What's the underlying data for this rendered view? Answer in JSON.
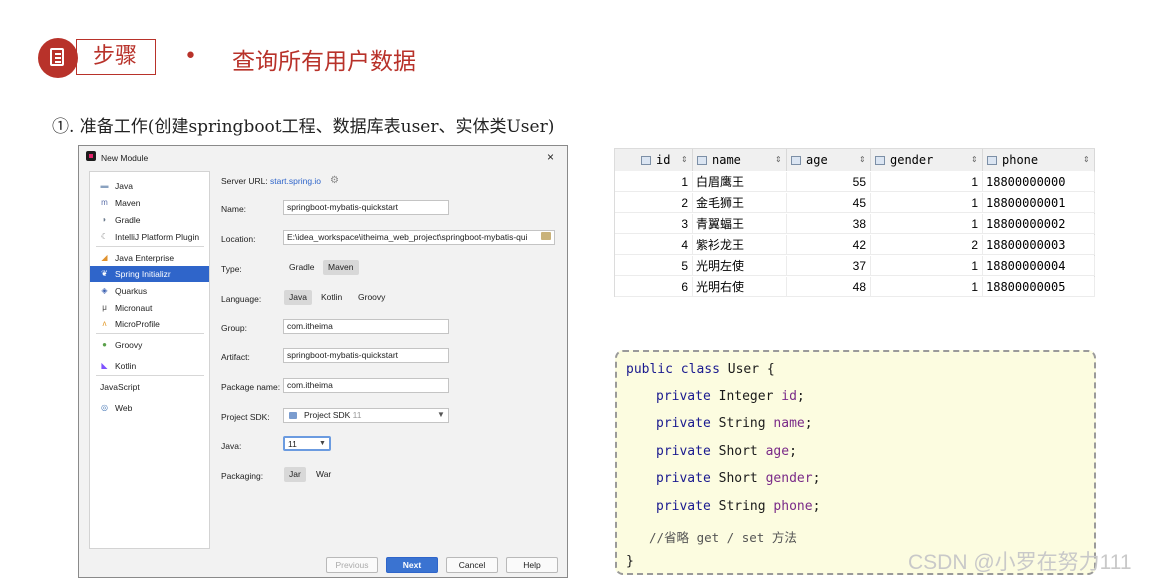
{
  "header": {
    "step_label": "步骤",
    "bullet": "•",
    "title": "查询所有用户数据",
    "subtitle": "①. 准备工作(创建springboot工程、数据库表user、实体类User)"
  },
  "dialog": {
    "title": "New Module",
    "close": "×",
    "sidebar": [
      {
        "label": "Java",
        "icon": "folder-icon"
      },
      {
        "label": "Maven",
        "icon": "maven-icon"
      },
      {
        "label": "Gradle",
        "icon": "gradle-icon"
      },
      {
        "label": "IntelliJ Platform Plugin",
        "icon": "plugin-icon"
      },
      {
        "label": "Java Enterprise",
        "icon": "enterprise-icon"
      },
      {
        "label": "Spring Initializr",
        "icon": "spring-icon",
        "selected": true
      },
      {
        "label": "Quarkus",
        "icon": "quarkus-icon"
      },
      {
        "label": "Micronaut",
        "icon": "micronaut-icon"
      },
      {
        "label": "MicroProfile",
        "icon": "microprofile-icon"
      },
      {
        "label": "Groovy",
        "icon": "groovy-icon"
      },
      {
        "label": "Kotlin",
        "icon": "kotlin-icon"
      },
      {
        "label": "JavaScript",
        "icon": ""
      },
      {
        "label": "Web",
        "icon": "web-icon"
      }
    ],
    "server_url_label": "Server URL:",
    "server_url": "start.spring.io",
    "name_label": "Name:",
    "name_value": "springboot-mybatis-quickstart",
    "location_label": "Location:",
    "location_value": "E:\\idea_workspace\\itheima_web_project\\springboot-mybatis-qui",
    "type_label": "Type:",
    "type_options": [
      "Gradle",
      "Maven"
    ],
    "type_selected": "Maven",
    "language_label": "Language:",
    "language_options": [
      "Java",
      "Kotlin",
      "Groovy"
    ],
    "language_selected": "Java",
    "group_label": "Group:",
    "group_value": "com.itheima",
    "artifact_label": "Artifact:",
    "artifact_value": "springboot-mybatis-quickstart",
    "package_label": "Package name:",
    "package_value": "com.itheima",
    "sdk_label": "Project SDK:",
    "sdk_value": "Project SDK",
    "sdk_version": "11",
    "java_label": "Java:",
    "java_value": "11",
    "packaging_label": "Packaging:",
    "packaging_options": [
      "Jar",
      "War"
    ],
    "packaging_selected": "Jar",
    "buttons": {
      "previous": "Previous",
      "next": "Next",
      "cancel": "Cancel",
      "help": "Help"
    },
    "accent_color": "#2f65ca"
  },
  "db_table": {
    "columns": [
      "id",
      "name",
      "age",
      "gender",
      "phone"
    ],
    "rows": [
      [
        "1",
        "白眉鹰王",
        "55",
        "1",
        "18800000000"
      ],
      [
        "2",
        "金毛狮王",
        "45",
        "1",
        "18800000001"
      ],
      [
        "3",
        "青翼蝠王",
        "38",
        "1",
        "18800000002"
      ],
      [
        "4",
        "紫衫龙王",
        "42",
        "2",
        "18800000003"
      ],
      [
        "5",
        "光明左使",
        "37",
        "1",
        "18800000004"
      ],
      [
        "6",
        "光明右使",
        "48",
        "1",
        "18800000005"
      ]
    ]
  },
  "code": {
    "l1_kw": "public class",
    "l1_rest": " User {",
    "fields": [
      {
        "kw": "private",
        "type": "Integer",
        "name": "id"
      },
      {
        "kw": "private",
        "type": "String",
        "name": "name"
      },
      {
        "kw": "private",
        "type": "Short",
        "name": "age"
      },
      {
        "kw": "private",
        "type": "Short",
        "name": "gender"
      },
      {
        "kw": "private",
        "type": "String",
        "name": "phone"
      }
    ],
    "comment": "//省略 get / set 方法",
    "close": "}"
  },
  "watermark": "CSDN @小罗在努力111"
}
